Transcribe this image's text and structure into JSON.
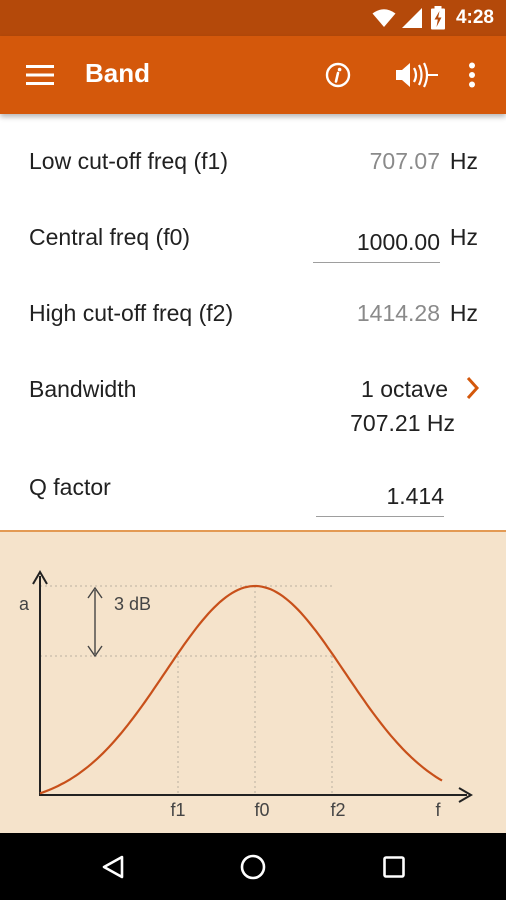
{
  "status_bar": {
    "time": "4:28",
    "icons": [
      "wifi-icon",
      "signal-icon",
      "battery-charging-icon"
    ]
  },
  "app_bar": {
    "title": "Band",
    "background": "#d4580b",
    "icons": [
      "menu-icon",
      "info-icon",
      "sound-icon",
      "more-vert-icon"
    ]
  },
  "fields": {
    "low_cutoff": {
      "label": "Low cut-off freq (f1)",
      "value": "707.07",
      "unit": "Hz"
    },
    "central": {
      "label": "Central freq (f0)",
      "value": "1000.00",
      "unit": "Hz"
    },
    "high_cutoff": {
      "label": "High cut-off freq (f2)",
      "value": "1414.28",
      "unit": "Hz"
    },
    "bandwidth": {
      "label": "Bandwidth",
      "selection": "1 octave",
      "value": "707.21 Hz"
    },
    "q_factor": {
      "label": "Q factor",
      "value": "1.414"
    }
  },
  "diagram": {
    "y_axis_label": "a",
    "x_axis_label": "f",
    "ticks": [
      "f1",
      "f0",
      "f2"
    ],
    "annotation": "3 dB",
    "curve_color": "#c8501a",
    "background": "#f5e3cb"
  },
  "nav_bar": {
    "icons": [
      "back-icon",
      "home-icon",
      "recents-icon"
    ]
  }
}
